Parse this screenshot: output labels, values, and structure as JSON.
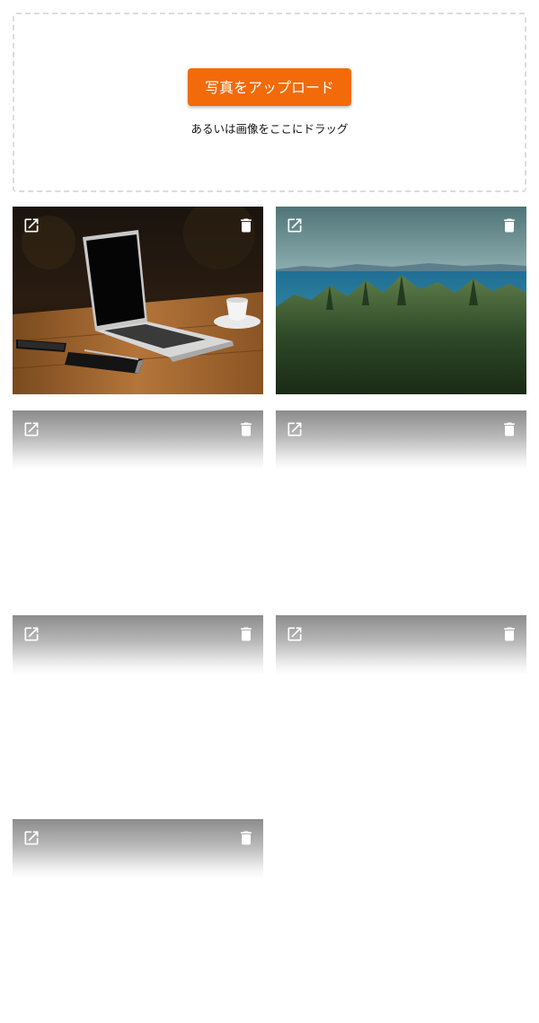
{
  "upload": {
    "button_label": "写真をアップロード",
    "hint": "あるいは画像をここにドラッグ",
    "button_color": "#f26a0a"
  },
  "gallery": {
    "tiles": [
      {
        "content": "laptop-on-wooden-table-photo",
        "loaded": true
      },
      {
        "content": "forest-and-sea-landscape-photo",
        "loaded": true
      },
      {
        "content": "placeholder",
        "loaded": false
      },
      {
        "content": "placeholder",
        "loaded": false
      },
      {
        "content": "placeholder",
        "loaded": false
      },
      {
        "content": "placeholder",
        "loaded": false
      },
      {
        "content": "placeholder",
        "loaded": false
      }
    ],
    "tile_icons": [
      "open-in-new-icon",
      "trash-icon"
    ]
  }
}
